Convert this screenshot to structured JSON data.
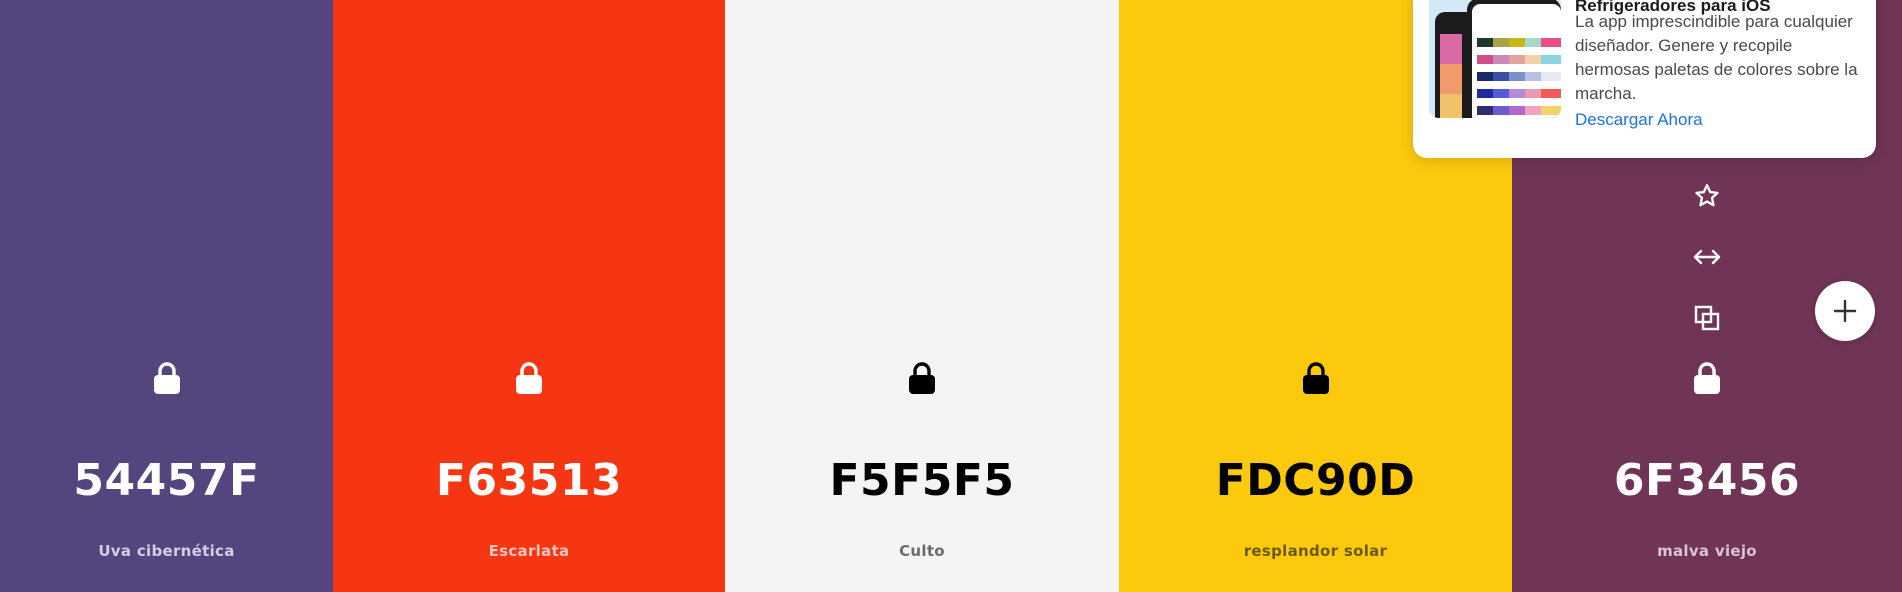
{
  "palette": {
    "colors": [
      {
        "hex": "54457F",
        "name": "Uva cibernética",
        "bg": "#54457F",
        "fg": "#ffffff",
        "label_color": "#d4cde3",
        "icon_color": "#ffffff"
      },
      {
        "hex": "F63513",
        "name": "Escarlata",
        "bg": "#F63513",
        "fg": "#ffffff",
        "label_color": "#fcc8bd",
        "icon_color": "#ffffff"
      },
      {
        "hex": "F5F5F5",
        "name": "Culto",
        "bg": "#F4F4F4",
        "fg": "#000000",
        "label_color": "#6b6b6b",
        "icon_color": "#000000"
      },
      {
        "hex": "FDC90D",
        "name": "resplandor solar",
        "bg": "#FCC90D",
        "fg": "#000000",
        "label_color": "#6b5a10",
        "icon_color": "#000000"
      },
      {
        "hex": "6F3456",
        "name": "malva viejo",
        "bg": "#6F3456",
        "fg": "#ffffff",
        "label_color": "#d9c4d0",
        "icon_color": "#ffffff"
      }
    ]
  },
  "tools": [
    "star-icon",
    "drag-icon",
    "copy-icon"
  ],
  "add_button": {
    "icon": "plus-icon"
  },
  "promo": {
    "title": "Refrigeradores para iOS",
    "description": "La app imprescindible para cualquier diseñador. Genere y recopile hermosas paletas de colores sobre la marcha.",
    "cta": "Descargar Ahora"
  }
}
